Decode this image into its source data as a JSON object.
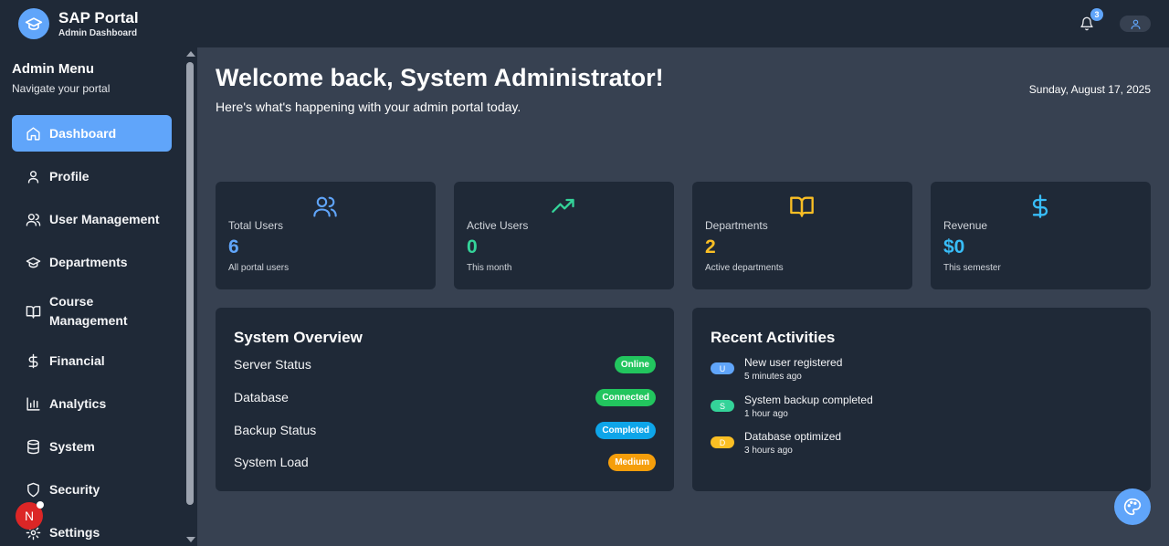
{
  "brand": {
    "title": "SAP Portal",
    "subtitle": "Admin Dashboard"
  },
  "notifications": {
    "count": "3"
  },
  "sidebar": {
    "title": "Admin Menu",
    "subtitle": "Navigate your portal",
    "items": [
      {
        "label": "Dashboard",
        "icon": "home-icon",
        "active": true
      },
      {
        "label": "Profile",
        "icon": "user-icon"
      },
      {
        "label": "User Management",
        "icon": "users-icon"
      },
      {
        "label": "Departments",
        "icon": "graduation-cap-icon"
      },
      {
        "label": "Course Management",
        "icon": "book-icon"
      },
      {
        "label": "Financial",
        "icon": "dollar-icon"
      },
      {
        "label": "Analytics",
        "icon": "bar-chart-icon"
      },
      {
        "label": "System",
        "icon": "database-icon"
      },
      {
        "label": "Security",
        "icon": "shield-icon"
      },
      {
        "label": "Settings",
        "icon": "gear-icon"
      }
    ],
    "avatar_initial": "N"
  },
  "main": {
    "welcome": "Welcome back, System Administrator!",
    "subtitle": "Here's what's happening with your admin portal today.",
    "date": "Sunday, August 17, 2025"
  },
  "stats": [
    {
      "label": "Total Users",
      "value": "6",
      "desc": "All portal users",
      "color": "#60a5fa",
      "icon": "users-icon"
    },
    {
      "label": "Active Users",
      "value": "0",
      "desc": "This month",
      "color": "#34d399",
      "icon": "trending-up-icon"
    },
    {
      "label": "Departments",
      "value": "2",
      "desc": "Active departments",
      "color": "#fbbf24",
      "icon": "book-open-icon"
    },
    {
      "label": "Revenue",
      "value": "$0",
      "desc": "This semester",
      "color": "#38bdf8",
      "icon": "dollar-icon"
    }
  ],
  "overview": {
    "title": "System Overview",
    "rows": [
      {
        "label": "Server Status",
        "status": "Online",
        "color": "#22c55e"
      },
      {
        "label": "Database",
        "status": "Connected",
        "color": "#22c55e"
      },
      {
        "label": "Backup Status",
        "status": "Completed",
        "color": "#0ea5e9"
      },
      {
        "label": "System Load",
        "status": "Medium",
        "color": "#f59e0b"
      }
    ]
  },
  "activities": {
    "title": "Recent Activities",
    "items": [
      {
        "badge": "U",
        "title": "New user registered",
        "time": "5 minutes ago",
        "color": "#60a5fa"
      },
      {
        "badge": "S",
        "title": "System backup completed",
        "time": "1 hour ago",
        "color": "#34d399"
      },
      {
        "badge": "D",
        "title": "Database optimized",
        "time": "3 hours ago",
        "color": "#fbbf24"
      }
    ]
  }
}
